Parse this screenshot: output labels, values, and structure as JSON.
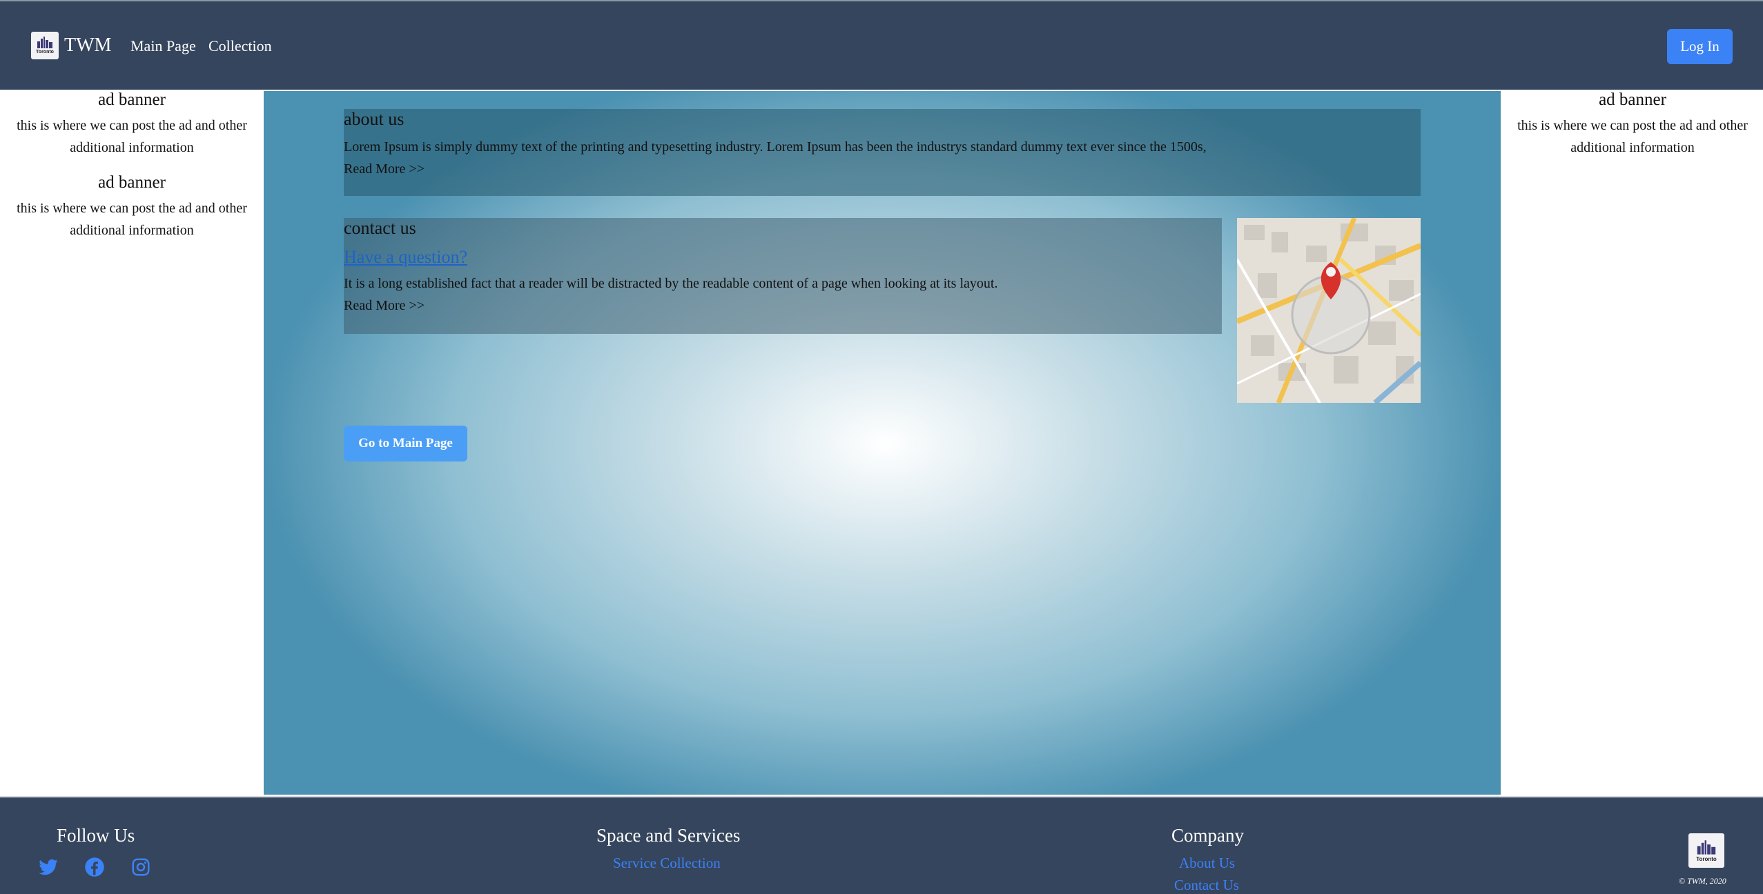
{
  "navbar": {
    "logo_text": "Toronto",
    "brand": "TWM",
    "links": [
      "Main Page",
      "Collection"
    ],
    "login_label": "Log In"
  },
  "sidebar_left": {
    "ads": [
      {
        "title": "ad banner",
        "text": "this is where we can post the ad and other additional information"
      },
      {
        "title": "ad banner",
        "text": "this is where we can post the ad and other additional information"
      }
    ]
  },
  "sidebar_right": {
    "ads": [
      {
        "title": "ad banner",
        "text": "this is where we can post the ad and other additional information"
      }
    ]
  },
  "main": {
    "about": {
      "title": "about us",
      "text": "Lorem Ipsum is simply dummy text of the printing and typesetting industry. Lorem Ipsum has been the industrys standard dummy text ever since the 1500s,",
      "read_more": "Read More >>"
    },
    "contact": {
      "title": "contact us",
      "link": "Have a question?",
      "text": "It is a long established fact that a reader will be distracted by the readable content of a page when looking at its layout.",
      "read_more": "Read More >>"
    },
    "main_button": "Go to Main Page",
    "colors": {
      "background_edge": "#4b91b1",
      "background_center": "#ffffff",
      "button": "#4a9ef5"
    }
  },
  "footer": {
    "follow_title": "Follow Us",
    "social_icons": [
      "twitter-icon",
      "facebook-icon",
      "instagram-icon"
    ],
    "services_title": "Space and Services",
    "services_links": [
      "Service Collection"
    ],
    "company_title": "Company",
    "company_links": [
      "About Us",
      "Contact Us"
    ],
    "logo_text": "Toronto",
    "copyright": "© TWM, 2020"
  },
  "colors": {
    "navbar": "#35455d",
    "accent": "#3b82f6",
    "link": "#1d63c7"
  }
}
